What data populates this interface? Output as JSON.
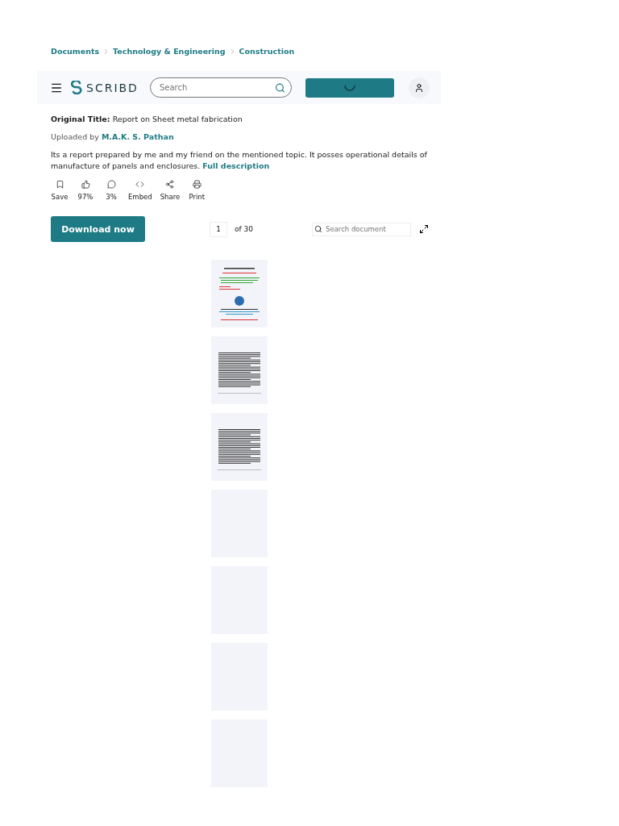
{
  "breadcrumbs": [
    "Documents",
    "Technology & Engineering",
    "Construction"
  ],
  "header": {
    "logo": "SCRIBD",
    "search": {
      "placeholder": "Search"
    },
    "cta": {
      "loading": true
    }
  },
  "original_title": {
    "label": "Original Title:",
    "value": "Report on Sheet metal fabrication"
  },
  "uploaded": {
    "label": "Uploaded by",
    "author": "M.A.K. S. Pathan"
  },
  "description": {
    "text": "Its a report prepared by me and my friend on the mentioned topic. It posses operational details of manufacture of panels and enclosures.",
    "link": "Full description"
  },
  "actions": [
    {
      "kind": "save",
      "label": "Save"
    },
    {
      "kind": "like",
      "label": "97%"
    },
    {
      "kind": "dislike",
      "label": "3%"
    },
    {
      "kind": "embed",
      "label": "Embed"
    },
    {
      "kind": "share",
      "label": "Share"
    },
    {
      "kind": "print",
      "label": "Print"
    }
  ],
  "download": "Download now",
  "pager": {
    "page": "1",
    "total": "of 30"
  },
  "doc_search": {
    "placeholder": "Search document"
  },
  "pages": [
    {
      "kind": "cover"
    },
    {
      "kind": "text"
    },
    {
      "kind": "text"
    },
    {
      "kind": "blank"
    },
    {
      "kind": "blank"
    },
    {
      "kind": "blank"
    },
    {
      "kind": "blank"
    }
  ]
}
